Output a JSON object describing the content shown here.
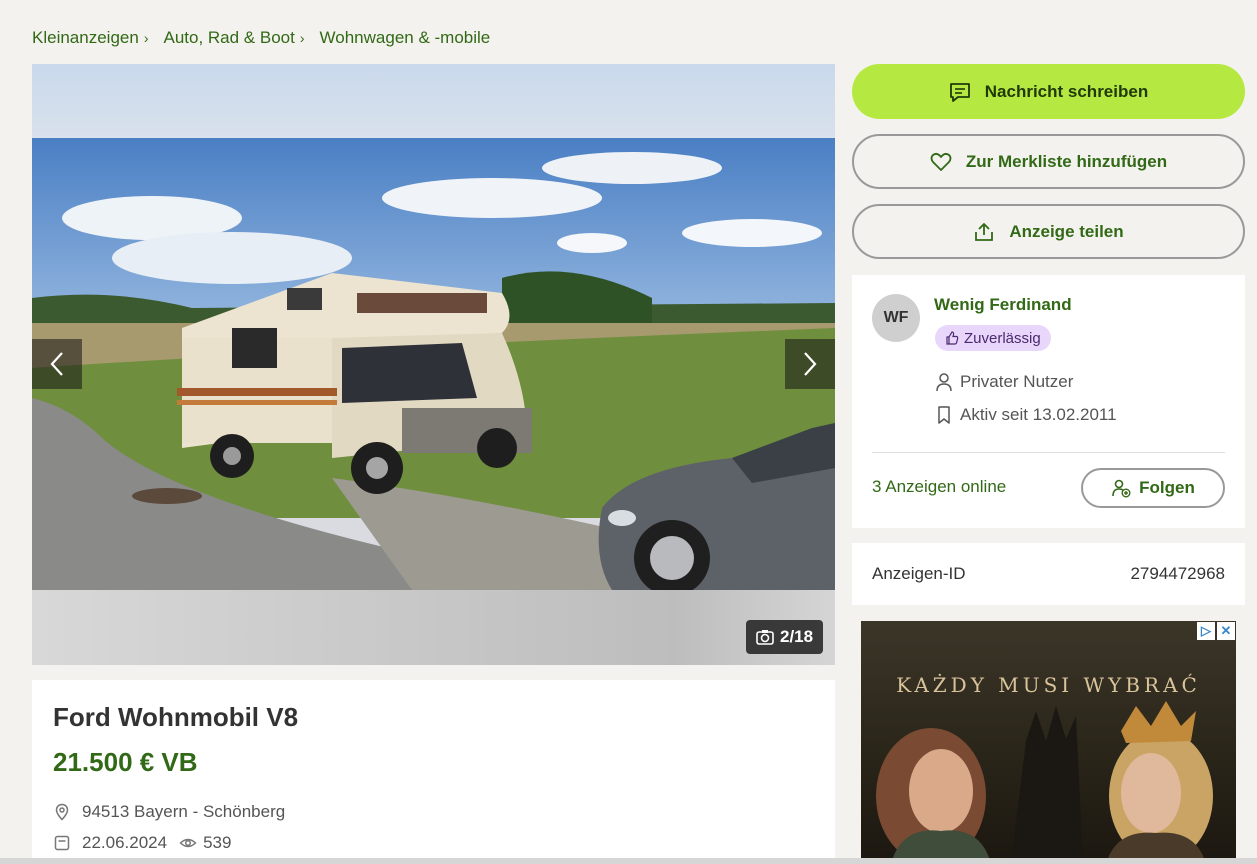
{
  "breadcrumb": {
    "items": [
      "Kleinanzeigen",
      "Auto, Rad & Boot",
      "Wohnwagen & -mobile"
    ],
    "separator": "›"
  },
  "gallery": {
    "counter": "2/18",
    "prev_icon": "chevron-left-icon",
    "next_icon": "chevron-right-icon",
    "camera_icon": "camera-icon"
  },
  "ad": {
    "title": "Ford Wohnmobil V8",
    "price": "21.500 € VB",
    "location": "94513 Bayern - Schönberg",
    "date": "22.06.2024",
    "views": "539"
  },
  "actions": {
    "message": "Nachricht schreiben",
    "favorite": "Zur Merkliste hinzufügen",
    "share": "Anzeige teilen"
  },
  "seller": {
    "initials": "WF",
    "name": "Wenig Ferdinand",
    "badge": "Zuverlässig",
    "type": "Privater Nutzer",
    "active_since": "Aktiv seit 13.02.2011",
    "ads_online": "3 Anzeigen online",
    "follow": "Folgen"
  },
  "ad_id": {
    "label": "Anzeigen-ID",
    "value": "2794472968"
  },
  "banner": {
    "headline": "KAŻDY MUSI WYBRAĆ"
  },
  "colors": {
    "accent_green": "#326916",
    "primary_button": "#b5e941",
    "badge_bg": "#e9d6fb",
    "page_bg": "#f3f2ee"
  }
}
